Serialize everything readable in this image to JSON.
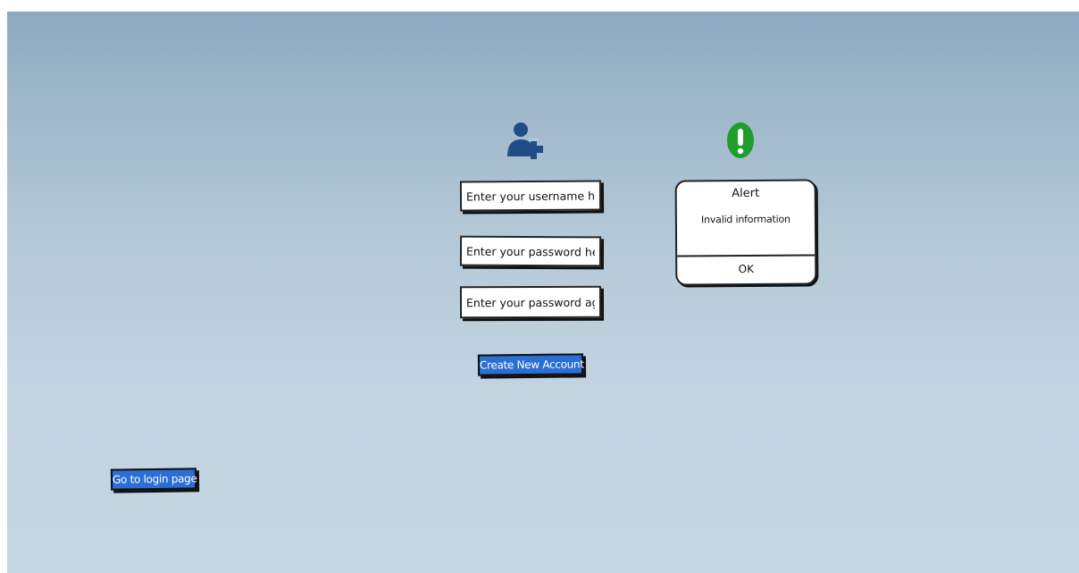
{
  "form": {
    "username_placeholder": "Enter your username here",
    "password_placeholder": "Enter your password here",
    "password_again_placeholder": "Enter your password again",
    "create_button_label": "Create New Account"
  },
  "alert": {
    "title": "Alert",
    "message": "Invalid information",
    "ok_label": "OK"
  },
  "nav": {
    "login_button_label": "Go to login page"
  },
  "icons": {
    "add_user": "add-user-icon",
    "alert": "exclamation-icon"
  },
  "colors": {
    "primary_button": "#2b6fd4",
    "add_user_icon": "#1f4e86",
    "alert_icon": "#1e9e2a",
    "background_top": "#8eaac0",
    "background_bottom": "#c5d6e3"
  }
}
